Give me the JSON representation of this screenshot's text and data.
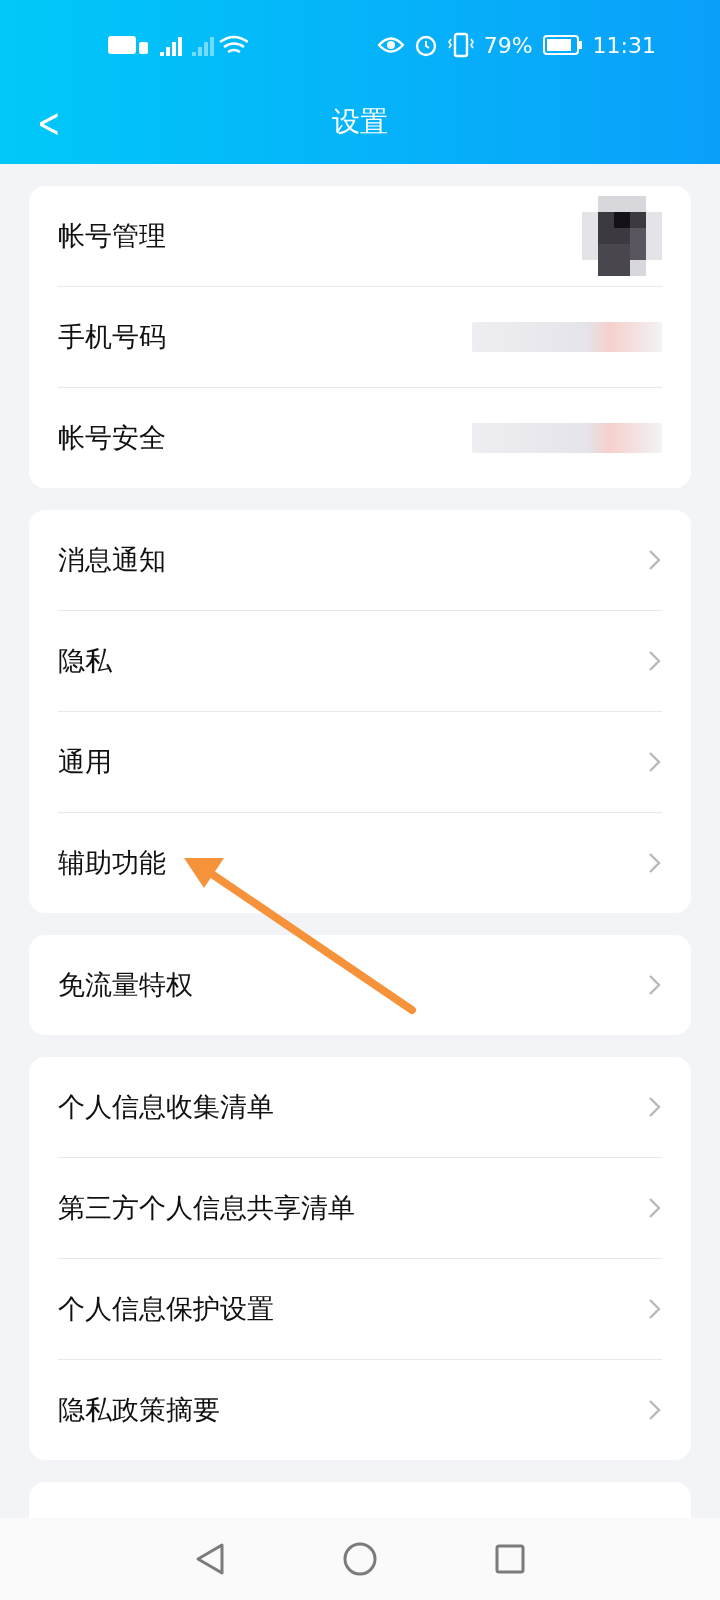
{
  "status_bar": {
    "battery": "79%",
    "time": "11:31"
  },
  "header": {
    "back": "<",
    "title": "设置"
  },
  "groups": [
    {
      "items": [
        {
          "label": "帐号管理",
          "kind": "avatar"
        },
        {
          "label": "手机号码",
          "kind": "hidden-value"
        },
        {
          "label": "帐号安全",
          "kind": "hidden-value"
        }
      ]
    },
    {
      "items": [
        {
          "label": "消息通知",
          "kind": "chevron"
        },
        {
          "label": "隐私",
          "kind": "chevron"
        },
        {
          "label": "通用",
          "kind": "chevron"
        },
        {
          "label": "辅助功能",
          "kind": "chevron"
        }
      ]
    },
    {
      "items": [
        {
          "label": "免流量特权",
          "kind": "chevron"
        }
      ]
    },
    {
      "items": [
        {
          "label": "个人信息收集清单",
          "kind": "chevron"
        },
        {
          "label": "第三方个人信息共享清单",
          "kind": "chevron"
        },
        {
          "label": "个人信息保护设置",
          "kind": "chevron"
        },
        {
          "label": "隐私政策摘要",
          "kind": "chevron"
        }
      ]
    },
    {
      "items": [
        {
          "kind": "cut"
        }
      ]
    }
  ],
  "annotation": {
    "kind": "arrow"
  }
}
